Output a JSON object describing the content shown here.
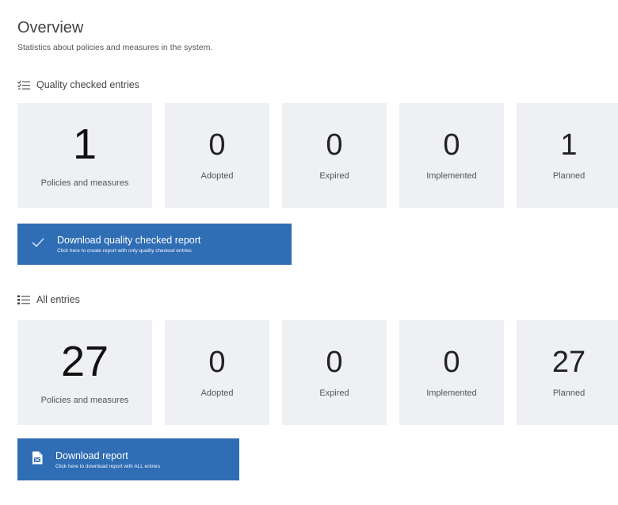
{
  "header": {
    "title": "Overview",
    "subtitle": "Statistics about policies and measures in the system."
  },
  "quality_section": {
    "title": "Quality checked entries",
    "icon": "checklist-icon",
    "cards": [
      {
        "value": "1",
        "label": "Policies and measures"
      },
      {
        "value": "0",
        "label": "Adopted"
      },
      {
        "value": "0",
        "label": "Expired"
      },
      {
        "value": "0",
        "label": "Implemented"
      },
      {
        "value": "1",
        "label": "Planned"
      }
    ],
    "button": {
      "icon": "check-icon",
      "title": "Download quality checked report",
      "subtitle": "Click here to create report with only quality checked entries"
    }
  },
  "all_section": {
    "title": "All entries",
    "icon": "list-icon",
    "cards": [
      {
        "value": "27",
        "label": "Policies and measures"
      },
      {
        "value": "0",
        "label": "Adopted"
      },
      {
        "value": "0",
        "label": "Expired"
      },
      {
        "value": "0",
        "label": "Implemented"
      },
      {
        "value": "27",
        "label": "Planned"
      }
    ],
    "button": {
      "icon": "spreadsheet-file-icon",
      "title": "Download report",
      "subtitle": "Click here to download report with ALL entries"
    }
  },
  "colors": {
    "accent": "#2f6db5",
    "card_bg": "#eef0f3"
  }
}
